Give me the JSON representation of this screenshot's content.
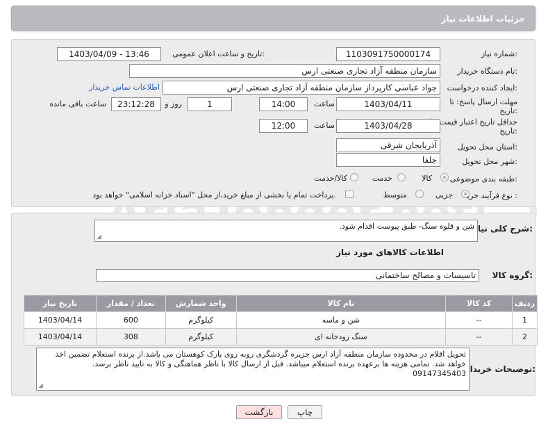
{
  "header": {
    "title": "جزئیات اطلاعات نیاز"
  },
  "form": {
    "need_number_label": "شماره نیاز:",
    "need_number": "1103091750000174",
    "announce_label": "تاریخ و ساعت اعلان عمومی:",
    "announce_value": "1403/04/09 - 13:46",
    "buyer_org_label": "نام دستگاه خریدار:",
    "buyer_org": "سازمان منطقه آزاد تجاری صنعتی ارس",
    "creator_label": "ایجاد کننده درخواست:",
    "creator": "جواد عباسی کارپرداز سازمان منطقه آزاد تجاری صنعتی ارس",
    "contact_link": "اطلاعات تماس خریدار",
    "deadline_label_1": "مهلت ارسال پاسخ: تا",
    "deadline_label_2": "تاریخ:",
    "deadline_date": "1403/04/11",
    "time_label": "ساعت",
    "deadline_time": "14:00",
    "days_value": "1",
    "days_label": "روز و",
    "remain_time": "23:12:28",
    "remain_label": "ساعت باقی مانده",
    "validity_label_1": "حداقل تاریخ اعتبار قیمت: تا",
    "validity_label_2": "تاریخ:",
    "validity_date": "1403/04/28",
    "validity_time": "12:00",
    "province_label": "استان محل تحویل:",
    "province": "آذربایجان شرقی",
    "city_label": "شهر محل تحویل:",
    "city": "جلفا",
    "category_label": "طبقه بندی موضوعی:",
    "cat_goods": "کالا",
    "cat_service": "خدمت",
    "cat_goods_service": "کالا/خدمت",
    "process_label": "نوع فرآیند خرید :",
    "proc_minor": "جزیی",
    "proc_medium": "متوسط",
    "payment_note": "پرداخت تمام یا بخشی از مبلغ خرید،از محل \"اسناد خزانه اسلامی\" خواهد بود."
  },
  "need": {
    "summary_label": "شرح کلی نیاز:",
    "summary": "شن و قلوه سنگ- طبق پیوست اقدام شود.",
    "goods_info_title": "اطلاعات کالاهای مورد نیاز",
    "group_label": "گروه کالا:",
    "group": "تاسیسات و مصالح ساختمانی"
  },
  "table": {
    "headers": [
      "ردیف",
      "کد کالا",
      "نام کالا",
      "واحد شمارش",
      "تعداد / مقدار",
      "تاریخ نیاز"
    ],
    "rows": [
      [
        "1",
        "--",
        "شن و ماسه",
        "کیلوگرم",
        "600",
        "1403/04/14"
      ],
      [
        "2",
        "--",
        "سنگ رودخانه ای",
        "کیلوگرم",
        "308",
        "1403/04/14"
      ]
    ]
  },
  "buyer_notes": {
    "label": "توضیحات خریدار:",
    "text": "تحویل اقلام در محدوده سازمان منطقه آزاد ارس  جزیره گردشگری روبه روی پارک کوهستان می باشد.از برنده استعلام تضمین اخذ خواهد شد. تمامی هزینه ها برعهده برنده استعلام میباشد. قبل از ارسال کالا با ناظر هماهنگی و کالا به تایید ناظر برسد. 09147345403"
  },
  "buttons": {
    "print": "چاپ",
    "back": "بازگشت"
  },
  "watermark": "AriaTender.net",
  "colors": {
    "header_bg": "#b9b9bf",
    "table_header_bg": "#9a9aa2",
    "back_button_bg": "#fde0e0",
    "link": "#2a5db0"
  }
}
